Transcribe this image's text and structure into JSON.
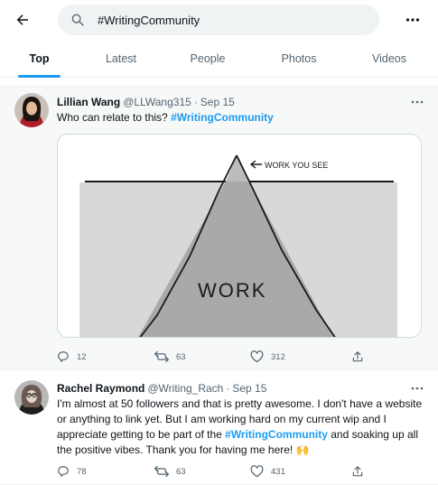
{
  "search": {
    "query": "#WritingCommunity"
  },
  "tabs": [
    {
      "label": "Top"
    },
    {
      "label": "Latest"
    },
    {
      "label": "People"
    },
    {
      "label": "Photos"
    },
    {
      "label": "Videos"
    }
  ],
  "icons": {
    "back": "arrow-left-icon",
    "search": "search-icon",
    "more": "more-horizontal-icon",
    "reply": "reply-icon",
    "retweet": "retweet-icon",
    "like": "heart-icon",
    "share": "share-icon"
  },
  "colors": {
    "accent": "#1d9bf0",
    "text": "#0f1419",
    "muted": "#536471",
    "highlight_bg": "#f7f9f9"
  },
  "tweets": [
    {
      "name": "Lillian Wang",
      "handle": "@LLWang315",
      "separator": "·",
      "date": "Sep 15",
      "text_before": "Who can relate to this? ",
      "hashtag": "#WritingCommunity",
      "text_after": "",
      "image_text": {
        "top_label": "WORK YOU SEE",
        "main_label": "WORK"
      },
      "replies": "12",
      "retweets": "63",
      "likes": "312"
    },
    {
      "name": "Rachel Raymond",
      "handle": "@Writing_Rach",
      "separator": "·",
      "date": "Sep 15",
      "text_before": "I'm almost at 50 followers and that is pretty awesome. I don't have a website or anything to link yet. But I am working hard on my current wip and I appreciate getting to be part of the ",
      "hashtag": "#WritingCommunity",
      "text_after": " and soaking up all the positive vibes. Thank you for having me here! 🙌",
      "replies": "78",
      "retweets": "63",
      "likes": "431"
    }
  ]
}
